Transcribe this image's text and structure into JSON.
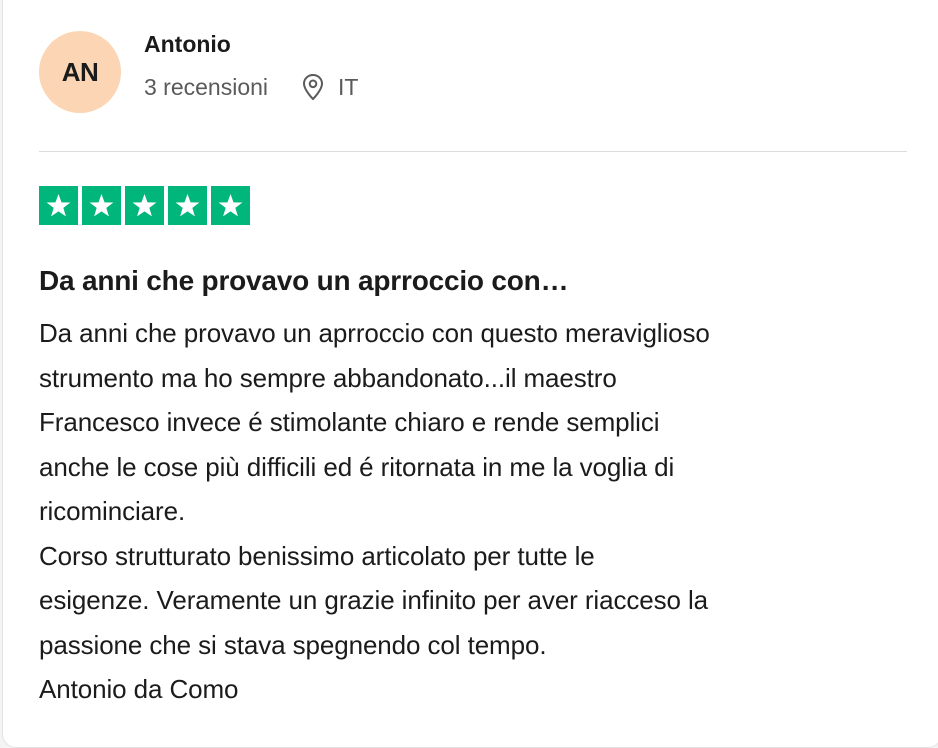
{
  "reviewer": {
    "initials": "AN",
    "name": "Antonio",
    "review_count": "3 recensioni",
    "location": "IT",
    "location_icon": "location-pin-icon",
    "avatar_color": "#fcd6b4"
  },
  "rating": {
    "stars": 5,
    "max": 5,
    "star_color": "#00b67a",
    "star_icon": "star-icon"
  },
  "review": {
    "title": "Da anni che provavo un aprroccio con…",
    "lines": [
      "Da anni che provavo un aprroccio con questo meraviglioso",
      "strumento ma ho sempre abbandonato...il maestro",
      "Francesco invece é stimolante chiaro e rende semplici",
      "anche le cose più difficili ed é ritornata in me la voglia di",
      "ricominciare.",
      "Corso strutturato benissimo articolato per tutte le",
      "esigenze. Veramente un grazie infinito per aver riacceso la",
      "passione che si stava spegnendo col tempo.",
      "Antonio da Como"
    ]
  }
}
